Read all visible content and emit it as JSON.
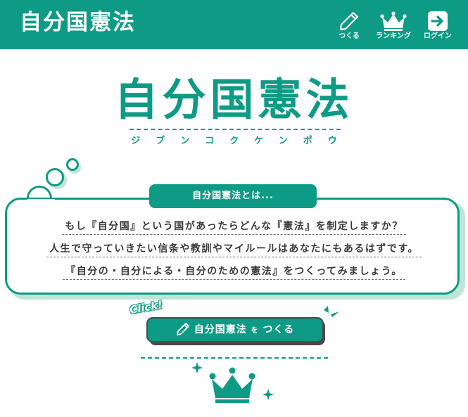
{
  "header": {
    "logo": "自分国憲法",
    "nav": [
      {
        "label": "つくる",
        "icon": "pencil-icon"
      },
      {
        "label": "ランキング",
        "icon": "crown-icon"
      },
      {
        "label": "ログイン",
        "icon": "login-arrow-icon"
      }
    ]
  },
  "hero": {
    "title": "自分国憲法",
    "ruby": "ジブンコクケンポウ"
  },
  "intro": {
    "label": "自分国憲法とは...",
    "lines": [
      "もし『自分国』という国があったらどんな『憲法』を制定しますか？",
      "人生で守っていきたい信条や教訓やマイルールはあなたにもあるはずです。",
      "『自分の・自分による・自分のための憲法』をつくってみましょう。"
    ]
  },
  "cta": {
    "click": "Click!",
    "label_main": "自分国憲法",
    "label_particle": "を",
    "label_verb": "つくる"
  },
  "colors": {
    "primary": "#0e9b85",
    "shadow": "#bfe5d9",
    "text": "#3a3a3a"
  }
}
